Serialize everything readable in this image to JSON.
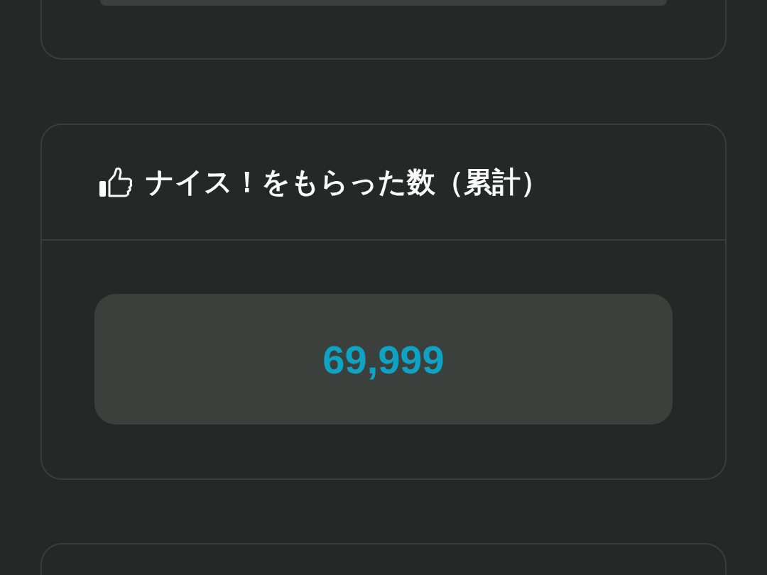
{
  "cards": [
    {
      "title": "ナイス！をもらった数（累計）",
      "value": "69,999"
    }
  ]
}
